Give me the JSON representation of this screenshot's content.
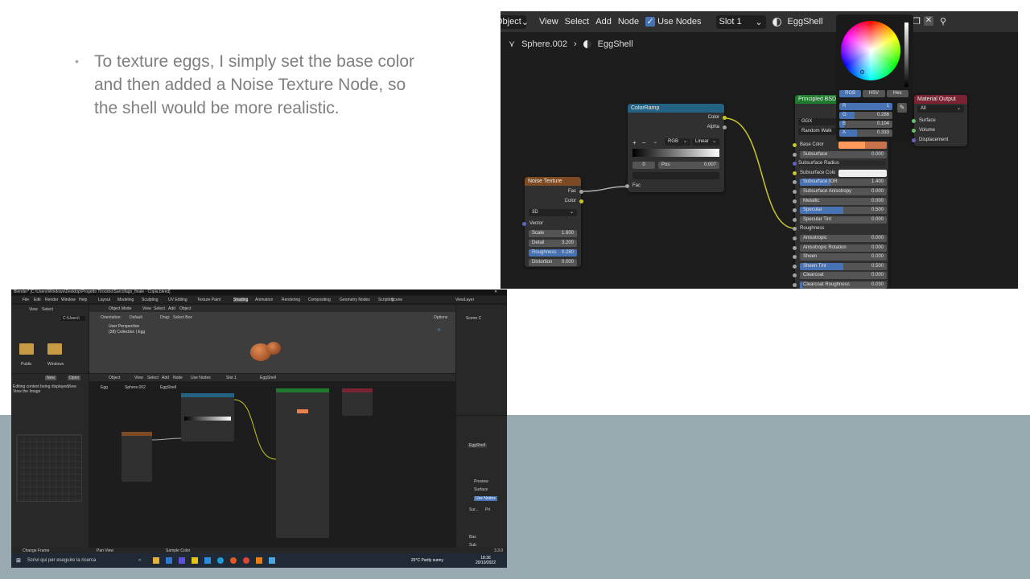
{
  "slide": {
    "bullet": "To texture eggs, I simply set the base color and then added a Noise Texture Node, so the shell would be more realistic."
  },
  "node_editor": {
    "header": {
      "object_menu": "Object",
      "view": "View",
      "select": "Select",
      "add": "Add",
      "node": "Node",
      "use_nodes": "Use Nodes",
      "slot": "Slot 1",
      "material": "EggShell"
    },
    "breadcrumb": {
      "object": "Sphere.002",
      "material": "EggShell"
    },
    "color_picker": {
      "tabs": [
        "RGB",
        "HSV",
        "Hex"
      ],
      "r_label": "R",
      "r": "1",
      "g_label": "G",
      "g": "0.286",
      "b_label": "B",
      "b": "0.104",
      "a_label": "A",
      "a": "0.333"
    },
    "colorramp": {
      "title": "ColorRamp",
      "out_color": "Color",
      "out_alpha": "Alpha",
      "mode": "RGB",
      "interp": "Linear",
      "index": "0",
      "pos_label": "Pos",
      "pos": "0.007",
      "in_fac": "Fac"
    },
    "noise": {
      "title": "Noise Texture",
      "out_fac": "Fac",
      "out_color": "Color",
      "dim": "3D",
      "in_vector": "Vector",
      "scale_label": "Scale",
      "scale": "1.600",
      "detail_label": "Detail",
      "detail": "3.200",
      "roughness_label": "Roughness",
      "roughness": "0.280",
      "distortion_label": "Distortion",
      "distortion": "0.000"
    },
    "bsdf": {
      "title": "Principled BSDF",
      "dist": "GGX",
      "sss": "Random Walk",
      "rows": [
        {
          "label": "Base Color",
          "value": ""
        },
        {
          "label": "Subsurface",
          "value": "0.000"
        },
        {
          "label": "Subsurface Radius",
          "value": ""
        },
        {
          "label": "Subsurface Colo",
          "value": ""
        },
        {
          "label": "Subsurface IOR",
          "value": "1.400"
        },
        {
          "label": "Subsurface Anisotropy",
          "value": "0.000"
        },
        {
          "label": "Metallic",
          "value": "0.000"
        },
        {
          "label": "Specular",
          "value": "0.500"
        },
        {
          "label": "Specular Tint",
          "value": "0.000"
        },
        {
          "label": "Roughness",
          "value": ""
        },
        {
          "label": "Anisotropic",
          "value": "0.000"
        },
        {
          "label": "Anisotropic Rotation",
          "value": "0.000"
        },
        {
          "label": "Sheen",
          "value": "0.000"
        },
        {
          "label": "Sheen Tint",
          "value": "0.500"
        },
        {
          "label": "Clearcoat",
          "value": "0.000"
        },
        {
          "label": "Clearcoat Roughness",
          "value": "0.030"
        }
      ]
    },
    "output": {
      "title": "Material Output",
      "target": "All",
      "surface": "Surface",
      "volume": "Volume",
      "displacement": "Displacement"
    }
  },
  "blender": {
    "title": "Blender* [C:\\Users\\Windows\\Desktop\\Progetto Tirocinio\\Sarcofago_finale - Copia.blend]",
    "menus": [
      "File",
      "Edit",
      "Render",
      "Window",
      "Help"
    ],
    "workspaces": [
      "Layout",
      "Modeling",
      "Sculpting",
      "UV Editing",
      "Texture Paint",
      "Shading",
      "Animation",
      "Rendering",
      "Compositing",
      "Geometry Nodes",
      "Scripting"
    ],
    "scene": "Scene",
    "view_layer": "ViewLayer",
    "viewport_mode": "Object Mode",
    "viewport_menus": [
      "View",
      "Select",
      "Add",
      "Object"
    ],
    "orientation_label": "Orientation:",
    "orientation": "Default",
    "drag_label": "Drag:",
    "drag": "Select Box",
    "options": "Options",
    "viewport_title": "User Perspective",
    "viewport_sub": "(38) Collection | Egg",
    "file_path": "C:\\Users\\",
    "folders": [
      "Public",
      "Windows"
    ],
    "img_new": "New",
    "img_open": "Open",
    "context_msg": "Editing context being displayed.",
    "context_view": "View",
    "view_image": "View the Image",
    "node_header": [
      "Object",
      "View",
      "Select",
      "Add",
      "Node",
      "Use Nodes",
      "Slot 1",
      "EggShell"
    ],
    "breadcrumb": [
      "Egg",
      "Sphere.002",
      "EggShell"
    ],
    "props": {
      "material": "EggShell",
      "preview": "Preview",
      "surface": "Surface",
      "use_nodes": "Use Nodes",
      "sur": "Sur...",
      "pri": "Pri",
      "bas": "Bas",
      "sub": "Sub"
    },
    "status": [
      "Change Frame",
      "Pan View",
      "Sample Color"
    ],
    "version": "3.3.0",
    "taskbar": {
      "search": "Scrivi qui per eseguire la ricerca",
      "weather": "20°C  Partly sunny",
      "time": "18:36",
      "date": "20/10/2022"
    }
  }
}
